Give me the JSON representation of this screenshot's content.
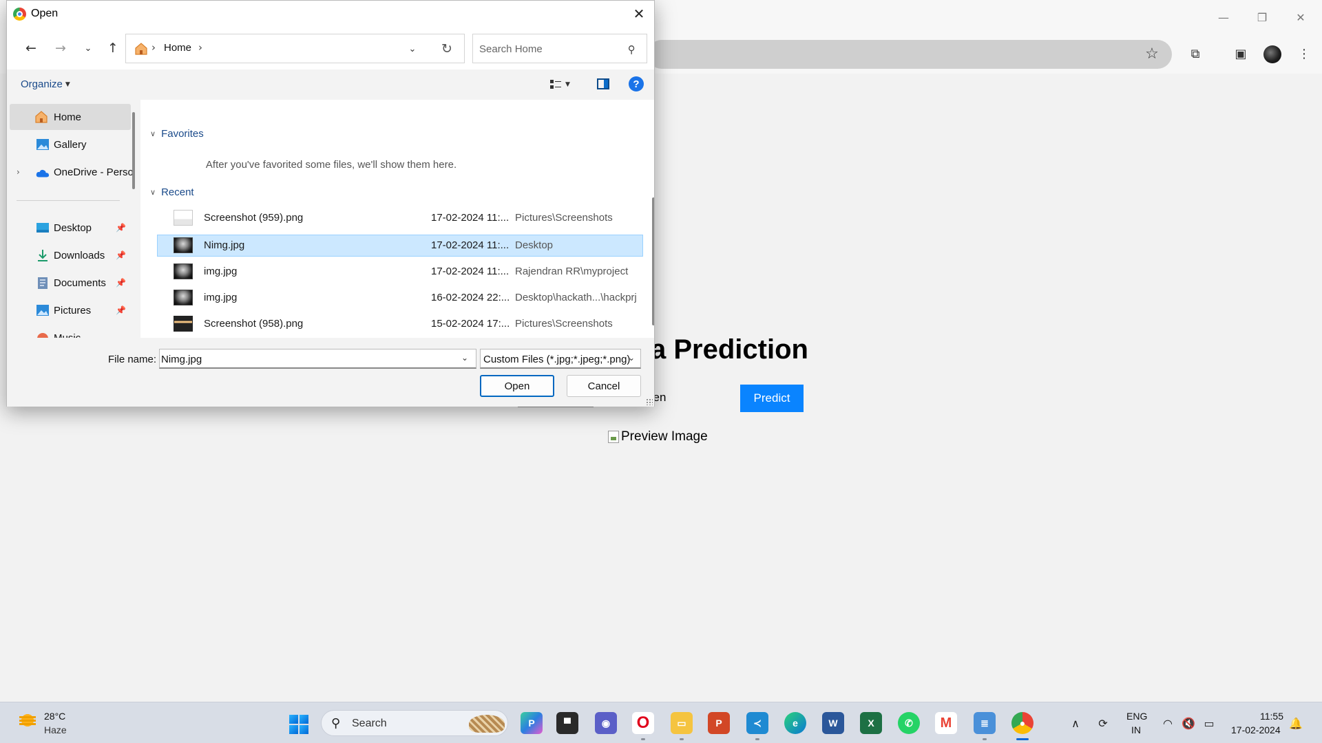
{
  "browser": {
    "page_title_fragment": "a Prediction",
    "choose_fragment": "sen",
    "predict_label": "Predict",
    "preview_alt": "Preview Image"
  },
  "dialog": {
    "title": "Open",
    "close_glyph": "✕",
    "breadcrumb": "Home",
    "search_placeholder": "Search Home",
    "organize_label": "Organize",
    "help_glyph": "?",
    "nav": {
      "home": "Home",
      "gallery": "Gallery",
      "onedrive": "OneDrive - Perso",
      "desktop": "Desktop",
      "downloads": "Downloads",
      "documents": "Documents",
      "pictures": "Pictures",
      "music": "Music"
    },
    "favorites_label": "Favorites",
    "favorites_empty": "After you've favorited some files, we'll show them here.",
    "recent_label": "Recent",
    "files": [
      {
        "name": "Screenshot (959).png",
        "date": "17-02-2024 11:...",
        "location": "Pictures\\Screenshots",
        "thumb": "screenshot-doc"
      },
      {
        "name": "Nimg.jpg",
        "date": "17-02-2024 11:...",
        "location": "Desktop",
        "thumb": "xray",
        "selected": true
      },
      {
        "name": "img.jpg",
        "date": "17-02-2024 11:...",
        "location": "Rajendran RR\\myproject",
        "thumb": "xray"
      },
      {
        "name": "img.jpg",
        "date": "16-02-2024 22:...",
        "location": "Desktop\\hackath...\\hackprj",
        "thumb": "xray"
      },
      {
        "name": "Screenshot (958).png",
        "date": "15-02-2024 17:...",
        "location": "Pictures\\Screenshots",
        "thumb": "screenshot-dark"
      }
    ],
    "file_name_label": "File name:",
    "file_name_value": "Nimg.jpg",
    "filter_value": "Custom Files (*.jpg;*.jpeg;*.png)",
    "open_label": "Open",
    "cancel_label": "Cancel"
  },
  "taskbar": {
    "temperature": "28°C",
    "condition": "Haze",
    "search_label": "Search",
    "lang_line1": "ENG",
    "lang_line2": "IN",
    "time": "11:55",
    "date": "17-02-2024",
    "pinned_apps": [
      "copilot",
      "terminal",
      "teams",
      "opera",
      "file-explorer",
      "powerpoint",
      "vscode",
      "edge",
      "word",
      "excel",
      "whatsapp",
      "gmail",
      "notepad",
      "chrome"
    ]
  },
  "colors": {
    "accent": "#0067c0",
    "predict_button": "#0a84ff",
    "selection": "#cce8ff"
  }
}
